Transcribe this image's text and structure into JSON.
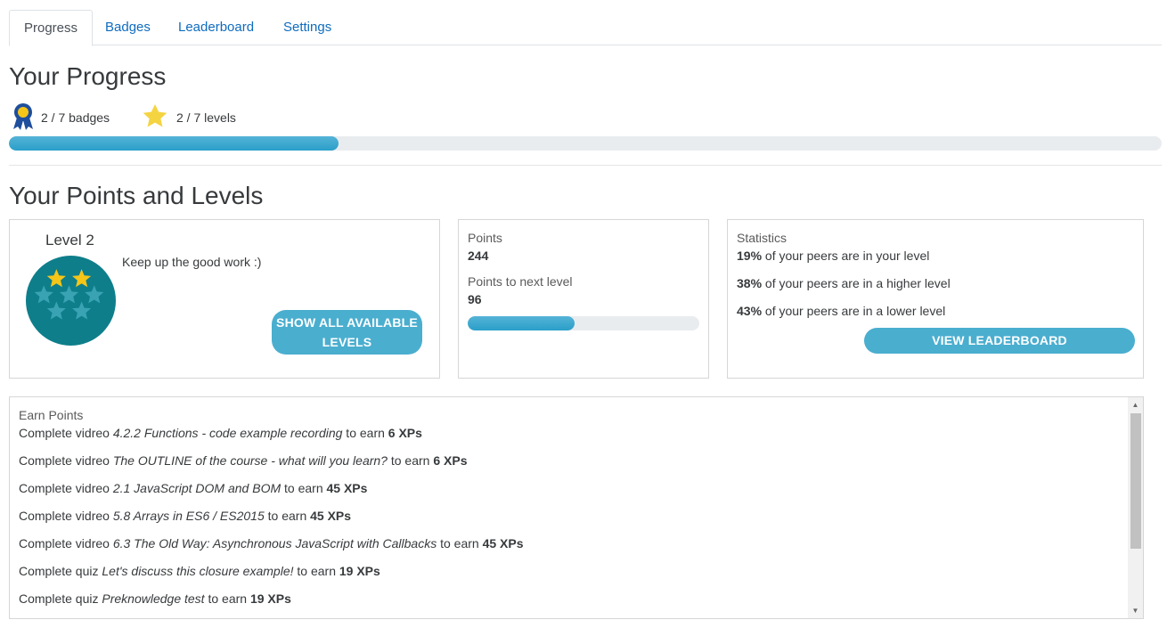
{
  "tabs": [
    {
      "label": "Progress"
    },
    {
      "label": "Badges"
    },
    {
      "label": "Leaderboard"
    },
    {
      "label": "Settings"
    }
  ],
  "progress": {
    "heading": "Your Progress",
    "badges_text": "2 / 7 badges",
    "levels_text": "2 / 7 levels",
    "fill_fraction": 0.286
  },
  "points_levels": {
    "heading": "Your Points and Levels",
    "level_title": "Level 2",
    "message": "Keep up the good work :)",
    "show_levels_button_line1": "SHOW ALL AVAILABLE",
    "show_levels_button_line2": "LEVELS",
    "points_label": "Points",
    "points_value": "244",
    "next_level_label": "Points to next level",
    "next_level_value": "96",
    "next_level_fill_fraction": 0.46,
    "statistics_label": "Statistics",
    "stats": [
      {
        "pct": "19%",
        "text": " of your peers are in your level"
      },
      {
        "pct": "38%",
        "text": " of your peers are in a higher level"
      },
      {
        "pct": "43%",
        "text": " of your peers are in a lower level"
      }
    ],
    "leaderboard_button": "VIEW LEADERBOARD"
  },
  "earn_points": {
    "label": "Earn Points",
    "items": [
      {
        "prefix": "Complete vidreo ",
        "name": "4.2.2 Functions - code example recording",
        "mid": " to earn ",
        "xp": "6 XPs"
      },
      {
        "prefix": "Complete vidreo ",
        "name": "The OUTLINE of the course - what will you learn?",
        "mid": " to earn ",
        "xp": "6 XPs"
      },
      {
        "prefix": "Complete vidreo ",
        "name": "2.1 JavaScript DOM and BOM",
        "mid": " to earn ",
        "xp": "45 XPs"
      },
      {
        "prefix": "Complete vidreo ",
        "name": "5.8 Arrays in ES6 / ES2015",
        "mid": " to earn ",
        "xp": "45 XPs"
      },
      {
        "prefix": "Complete vidreo ",
        "name": "6.3 The Old Way: Asynchronous JavaScript with Callbacks",
        "mid": " to earn ",
        "xp": "45 XPs"
      },
      {
        "prefix": "Complete quiz ",
        "name": "Let's discuss this closure example!",
        "mid": " to earn ",
        "xp": "19 XPs"
      },
      {
        "prefix": "Complete quiz ",
        "name": "Preknowledge test",
        "mid": " to earn ",
        "xp": "19 XPs"
      }
    ]
  },
  "colors": {
    "link": "#0f6cbf",
    "progress": "#2a9fc9",
    "button": "#4aaecf",
    "level_badge": "#0e7e8b",
    "star_gold": "#f5c518",
    "star_teal": "#3aa3b3",
    "ribbon_blue": "#1f4e9c"
  },
  "icons": {
    "badges": "ribbon-medal-icon",
    "levels": "star-icon"
  }
}
